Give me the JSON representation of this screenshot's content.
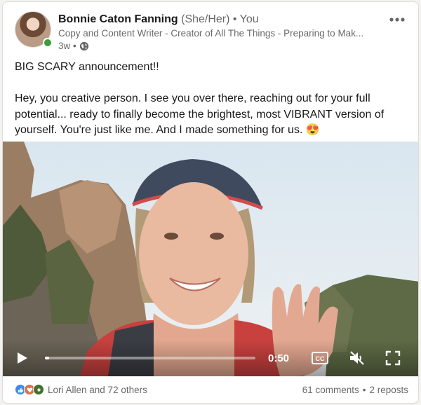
{
  "post": {
    "author": {
      "name": "Bonnie Caton Fanning",
      "pronouns": "(She/Her)",
      "connection": "• You",
      "headline": "Copy and Content Writer - Creator of All The Things - Preparing to Mak...",
      "time_ago": "3w •",
      "online": true
    },
    "text": {
      "line1": "BIG SCARY announcement!!",
      "line2": "Hey, you creative person. I see you over there, reaching out for your full potential... ready to finally become the brightest, most VIBRANT version of yourself. You're just like me. And I made something for us.",
      "emoji": "😍"
    },
    "video": {
      "time": "0:50",
      "progress_fraction": 0.02
    },
    "social": {
      "reactions_text": "Lori Allen and 72 others",
      "comments": "61 comments",
      "separator": "•",
      "reposts": "2 reposts"
    }
  },
  "colors": {
    "online_green": "#3a9f3a",
    "like_blue": "#378fe9",
    "love_red": "#df704d",
    "celebrate_green": "#44712e"
  },
  "icons": {
    "more": "more-horizontal-icon",
    "visibility": "globe-icon",
    "play": "play-icon",
    "captions": "closed-captions-icon",
    "mute": "volume-muted-icon",
    "fullscreen": "fullscreen-icon",
    "reactions": [
      "like-icon",
      "love-icon",
      "celebrate-icon"
    ]
  }
}
